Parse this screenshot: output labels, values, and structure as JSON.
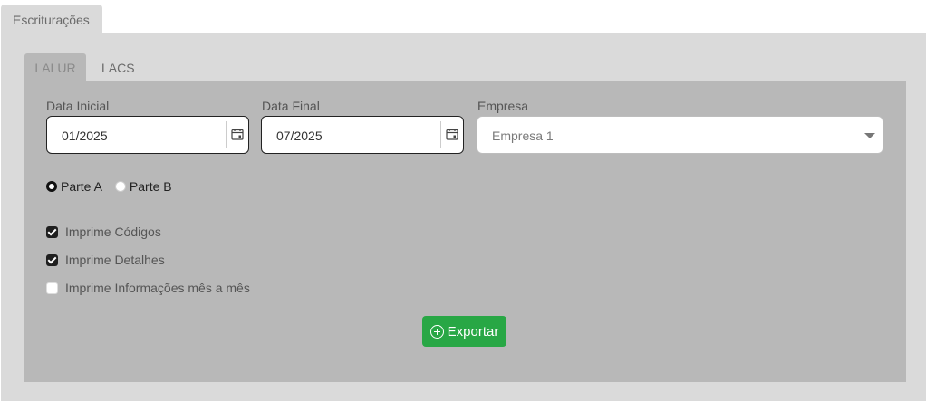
{
  "outer_tab": {
    "label": "Escriturações"
  },
  "inner_tabs": [
    {
      "label": "LALUR",
      "active": true
    },
    {
      "label": "LACS",
      "active": false
    }
  ],
  "form": {
    "data_inicial": {
      "label": "Data Inicial",
      "value": "01/2025",
      "icon": "calendar-icon"
    },
    "data_final": {
      "label": "Data Final",
      "value": "07/2025",
      "icon": "calendar-icon"
    },
    "empresa": {
      "label": "Empresa",
      "value": "Empresa 1",
      "icon": "chevron-down-icon"
    },
    "radios": [
      {
        "label": "Parte A",
        "checked": true
      },
      {
        "label": "Parte B",
        "checked": false
      }
    ],
    "checkboxes": [
      {
        "label": "Imprime Códigos",
        "checked": true
      },
      {
        "label": "Imprime Detalhes",
        "checked": true
      },
      {
        "label": "Imprime Informações mês a mês",
        "checked": false
      }
    ],
    "export_button": {
      "label": "Exportar",
      "icon": "plus-circle-icon",
      "color": "#28a745"
    }
  }
}
